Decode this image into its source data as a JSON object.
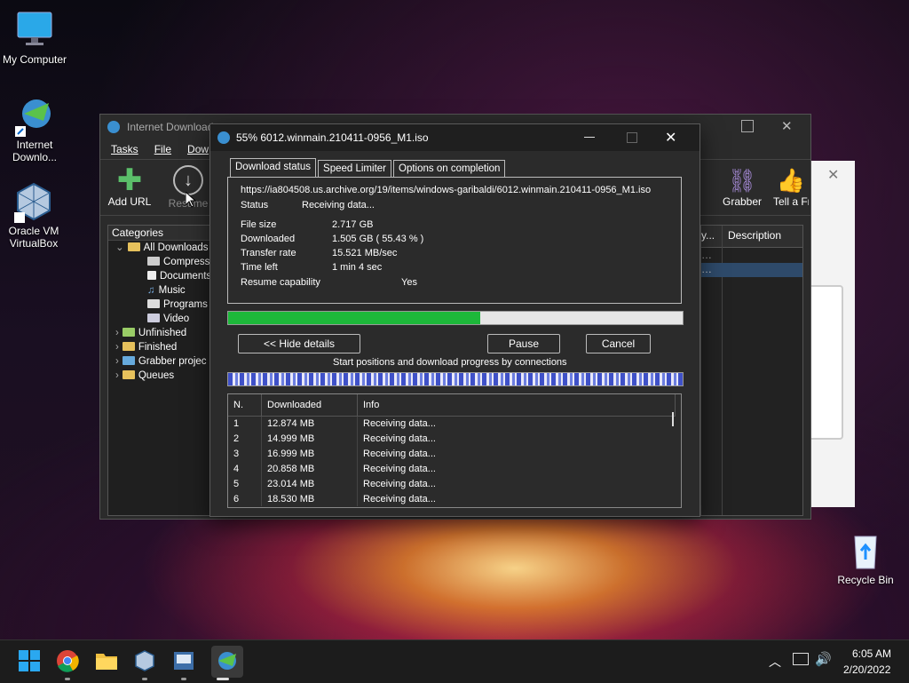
{
  "desktop": {
    "icons": [
      {
        "label": "My Computer",
        "icon": "monitor-icon"
      },
      {
        "label": "Internet Downlo...",
        "icon": "idm-icon"
      },
      {
        "label": "Oracle VM VirtualBox",
        "icon": "virtualbox-icon"
      },
      {
        "label": "Recycle Bin",
        "icon": "recycle-bin-icon"
      }
    ]
  },
  "idm_main": {
    "title": "Internet Download",
    "menu": [
      "Tasks",
      "File",
      "Dow"
    ],
    "toolbar": {
      "add_url": "Add URL",
      "resume": "Resume",
      "grabber": "Grabber",
      "tell_friend": "Tell a Fr"
    },
    "categories_header": "Categories",
    "tree": [
      "All Downloads",
      "Compresse",
      "Documents",
      "Music",
      "Programs",
      "Video",
      "Unfinished",
      "Finished",
      "Grabber projec",
      "Queues"
    ],
    "list_headers": [
      "y...",
      "Description"
    ]
  },
  "dialog": {
    "title": "55% 6012.winmain.210411-0956_M1.iso",
    "tabs": [
      "Download status",
      "Speed Limiter",
      "Options on completion"
    ],
    "url": "https://ia804508.us.archive.org/19/items/windows-garibaldi/6012.winmain.210411-0956_M1.iso",
    "status_label": "Status",
    "status_value": "Receiving data...",
    "fields": [
      {
        "label": "File size",
        "value": "2.717  GB"
      },
      {
        "label": "Downloaded",
        "value": "1.505  GB  ( 55.43 % )"
      },
      {
        "label": "Transfer rate",
        "value": "15.521  MB/sec"
      },
      {
        "label": "Time left",
        "value": "1 min 4 sec"
      },
      {
        "label": "Resume capability",
        "value": "Yes"
      }
    ],
    "progress": 0.5543,
    "buttons": {
      "hide_details": "<< Hide details",
      "pause": "Pause",
      "cancel": "Cancel"
    },
    "connections_caption": "Start positions and download progress by connections",
    "conn_headers": [
      "N.",
      "Downloaded",
      "Info"
    ],
    "connections": [
      {
        "n": "1",
        "downloaded": "12.874  MB",
        "info": "Receiving data..."
      },
      {
        "n": "2",
        "downloaded": "14.999  MB",
        "info": "Receiving data..."
      },
      {
        "n": "3",
        "downloaded": "16.999  MB",
        "info": "Receiving data..."
      },
      {
        "n": "4",
        "downloaded": "20.858  MB",
        "info": "Receiving data..."
      },
      {
        "n": "5",
        "downloaded": "23.014  MB",
        "info": "Receiving data..."
      },
      {
        "n": "6",
        "downloaded": "18.530  MB",
        "info": "Receiving data..."
      }
    ]
  },
  "taskbar": {
    "time": "6:05 AM",
    "date": "2/20/2022",
    "apps": [
      "start-icon",
      "chrome-icon",
      "file-explorer-icon",
      "virtualbox-icon",
      "vm-app-icon",
      "idm-icon"
    ]
  },
  "colors": {
    "progress": "#1db83a",
    "accent": "#0078d4"
  }
}
